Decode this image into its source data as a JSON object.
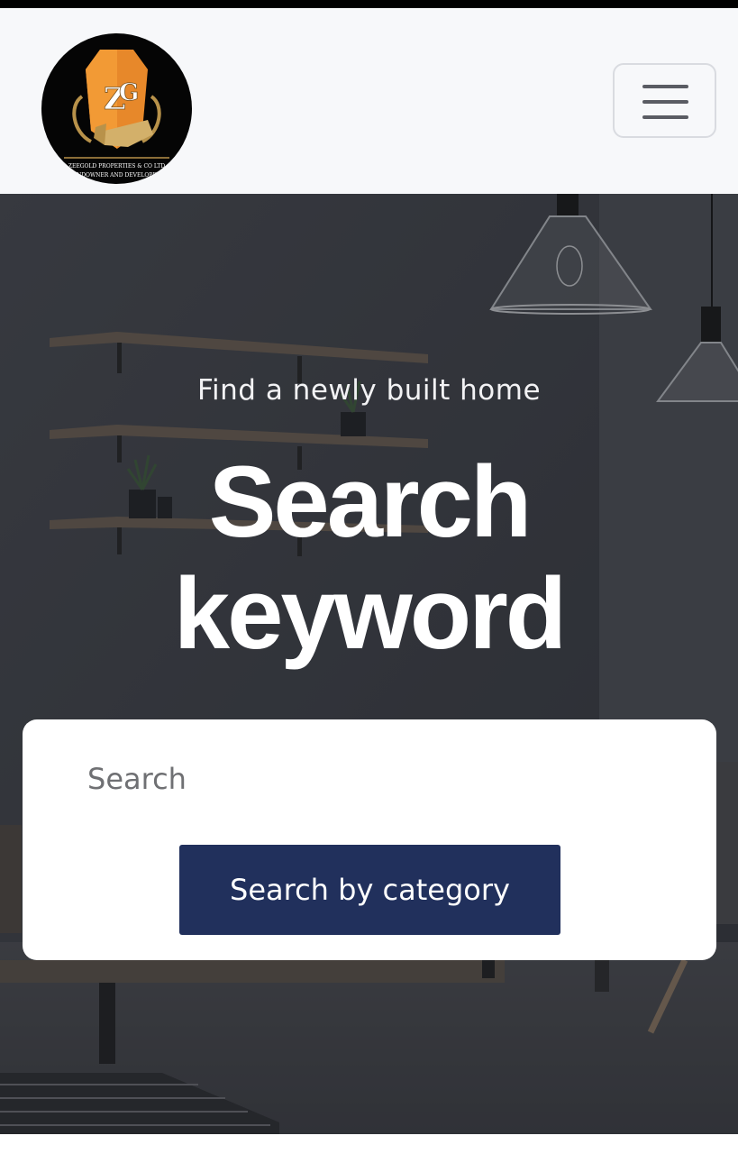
{
  "header": {
    "logo": {
      "initials": "ZG",
      "company_text_line1": "ZEEGOLD PROPERTIES & CO LTD",
      "company_text_line2": "LANDOWNER AND DEVELOPERS"
    },
    "menu_button_label": "Toggle navigation",
    "menu_icon": "hamburger-icon"
  },
  "hero": {
    "subtitle": "Find a newly built home",
    "title_line1": "Search",
    "title_line2": "keyword"
  },
  "search": {
    "placeholder": "Search",
    "value": "",
    "category_button_label": "Search by category"
  },
  "colors": {
    "navbar_bg": "#f7f8fa",
    "button_bg": "#21305c",
    "logo_gold": "#e7882a"
  }
}
